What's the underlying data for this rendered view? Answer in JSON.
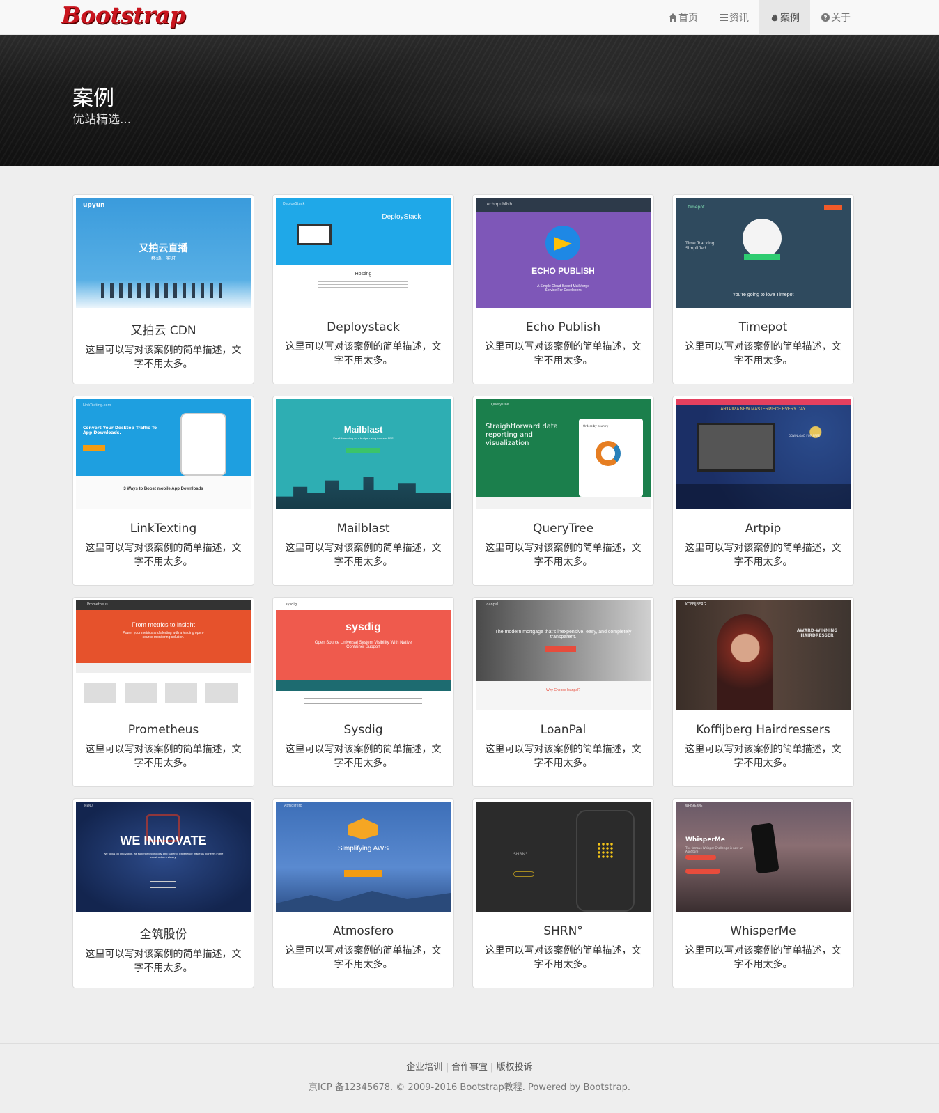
{
  "brand": "Bootstrap",
  "nav": [
    {
      "label": "首页",
      "icon": "home-icon"
    },
    {
      "label": "资讯",
      "icon": "list-icon"
    },
    {
      "label": "案例",
      "icon": "fire-icon"
    },
    {
      "label": "关于",
      "icon": "question-circle-icon"
    }
  ],
  "jumbotron": {
    "title": "案例",
    "subtitle": "优站精选..."
  },
  "description": "这里可以写对该案例的简单描述，文字不用太多。",
  "cases": [
    {
      "name": "又拍云 CDN",
      "thumb": {
        "logo": "upyun",
        "headline": "又拍云直播",
        "sub": "移动、实时"
      }
    },
    {
      "name": "Deploystack",
      "thumb": {
        "logo": "DeployStack",
        "headline": "DeployStack",
        "sub": "Hosting"
      }
    },
    {
      "name": "Echo Publish",
      "thumb": {
        "logo": "echopublish",
        "headline": "ECHO PUBLISH",
        "sub": "A Simple Cloud-Based MailMerge Service For Developers"
      }
    },
    {
      "name": "Timepot",
      "thumb": {
        "logo": "timepot",
        "headline": "Time Tracking, Simplified.",
        "sub": "You're going to love Timepot"
      }
    },
    {
      "name": "LinkTexting",
      "thumb": {
        "logo": "LinkTexting.com",
        "headline": "Convert Your Desktop Traffic To App Downloads.",
        "sub": "3 Ways to Boost mobile App Downloads"
      }
    },
    {
      "name": "Mailblast",
      "thumb": {
        "logo": "Mailblast",
        "headline": "Mailblast",
        "sub": "Email Marketing on a budget using Amazon SES"
      }
    },
    {
      "name": "QueryTree",
      "thumb": {
        "logo": "QueryTree",
        "headline": "Straightforward data reporting and visualization",
        "sub": "Orders by country"
      }
    },
    {
      "name": "Artpip",
      "thumb": {
        "logo": "ARTPIP",
        "headline": "ARTPIP A NEW MASTERPIECE EVERY DAY",
        "sub": "DOWNLOAD FOR FREE"
      }
    },
    {
      "name": "Prometheus",
      "thumb": {
        "logo": "Prometheus",
        "headline": "From metrics to insight",
        "sub": "Power your metrics and alerting with a leading open-source monitoring solution."
      }
    },
    {
      "name": "Sysdig",
      "thumb": {
        "logo": "sysdig",
        "headline": "sysdig",
        "sub": "Open Source Universal System Visibility With Native Container Support"
      }
    },
    {
      "name": "LoanPal",
      "thumb": {
        "logo": "loanpal",
        "headline": "The modern mortgage that's inexpensive, easy, and completely transparent.",
        "sub": "Why Choose loanpal?"
      }
    },
    {
      "name": "Koffijberg Hairdressers",
      "thumb": {
        "logo": "KOFFIJBERG",
        "headline": "AWARD-WINNING HAIRDRESSER",
        "sub": ""
      }
    },
    {
      "name": "全筑股份",
      "thumb": {
        "logo": "MENU",
        "headline": "WE INNOVATE",
        "sub": "We focus on innovation, as superior technology and superior experience make us pioneers in the construction industry."
      }
    },
    {
      "name": "Atmosfero",
      "thumb": {
        "logo": "Atmosfero",
        "headline": "Simplifying AWS",
        "sub": ""
      }
    },
    {
      "name": "SHRN°",
      "thumb": {
        "logo": "SHRN°",
        "headline": "",
        "sub": ""
      }
    },
    {
      "name": "WhisperMe",
      "thumb": {
        "logo": "WHISPERME",
        "headline": "WhisperMe",
        "sub": "The famous Whisper Challenge is now an AppStore"
      }
    }
  ],
  "footer": {
    "links": [
      "企业培训",
      "合作事宜",
      "版权投诉"
    ],
    "separator": "|",
    "copyright": "京ICP 备12345678. © 2009-2016 Bootstrap教程. Powered by Bootstrap."
  },
  "colors": {
    "brand": "#c9151e",
    "navbar_bg": "#f8f8f8",
    "page_bg": "#eeeeee"
  }
}
